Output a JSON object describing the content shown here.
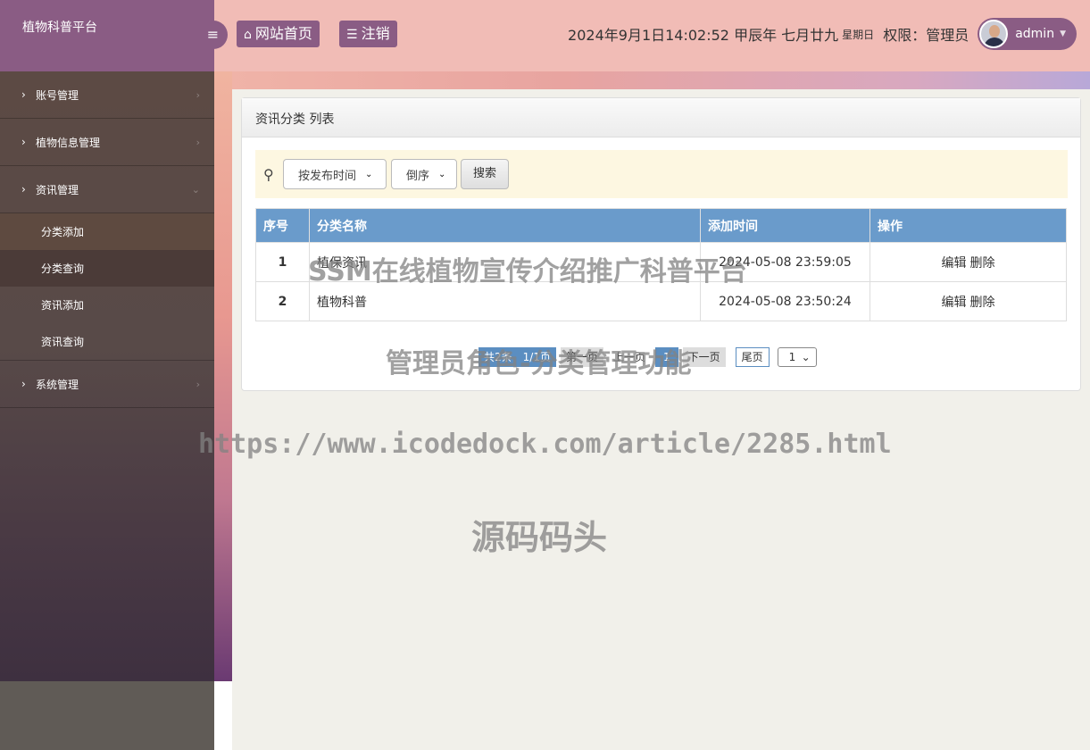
{
  "brand": {
    "title": "植物科普平台"
  },
  "header": {
    "menu_toggle_icon": "hamburger-icon",
    "home_label": "网站首页",
    "home_icon": "home-icon",
    "logout_label": "注销",
    "logout_icon": "list-icon",
    "datetime": "2024年9月1日14:02:52 甲辰年 七月廿九",
    "weekday": "星期日",
    "permission": "权限：管理员",
    "username": "admin"
  },
  "sidebar": {
    "items": [
      {
        "label": "账号管理",
        "expanded": false
      },
      {
        "label": "植物信息管理",
        "expanded": false
      },
      {
        "label": "资讯管理",
        "expanded": true,
        "children": [
          {
            "label": "分类添加"
          },
          {
            "label": "分类查询"
          },
          {
            "label": "资讯添加"
          },
          {
            "label": "资讯查询"
          }
        ]
      },
      {
        "label": "系统管理",
        "expanded": false
      }
    ]
  },
  "panel": {
    "title": "资讯分类 列表",
    "search": {
      "sort_field": "按发布时间",
      "sort_order": "倒序",
      "button_label": "搜索"
    },
    "table": {
      "columns": [
        "序号",
        "分类名称",
        "添加时间",
        "操作"
      ],
      "rows": [
        {
          "no": "1",
          "name": "植保资讯",
          "time": "2024-05-08 23:59:05",
          "edit": "编辑",
          "delete": "删除"
        },
        {
          "no": "2",
          "name": "植物科普",
          "time": "2024-05-08 23:50:24",
          "edit": "编辑",
          "delete": "删除"
        }
      ]
    },
    "pager": {
      "total": "共2条",
      "pages": "1/1页",
      "first": "第一页",
      "prev": "上一页",
      "current": "1",
      "next": "下一页",
      "last": "尾页",
      "jump_value": "1"
    }
  },
  "watermarks": {
    "line1": "SSM在线植物宣传介绍推广科普平台",
    "line2": "管理员角色-分类管理功能",
    "line3": "https://www.icodedock.com/article/2285.html",
    "line4": "源码码头"
  },
  "colors": {
    "accent": "#8a5c84",
    "header_bg": "#f1bcb6",
    "table_head": "#6a9bcb",
    "search_bg": "#fdf7e1"
  }
}
